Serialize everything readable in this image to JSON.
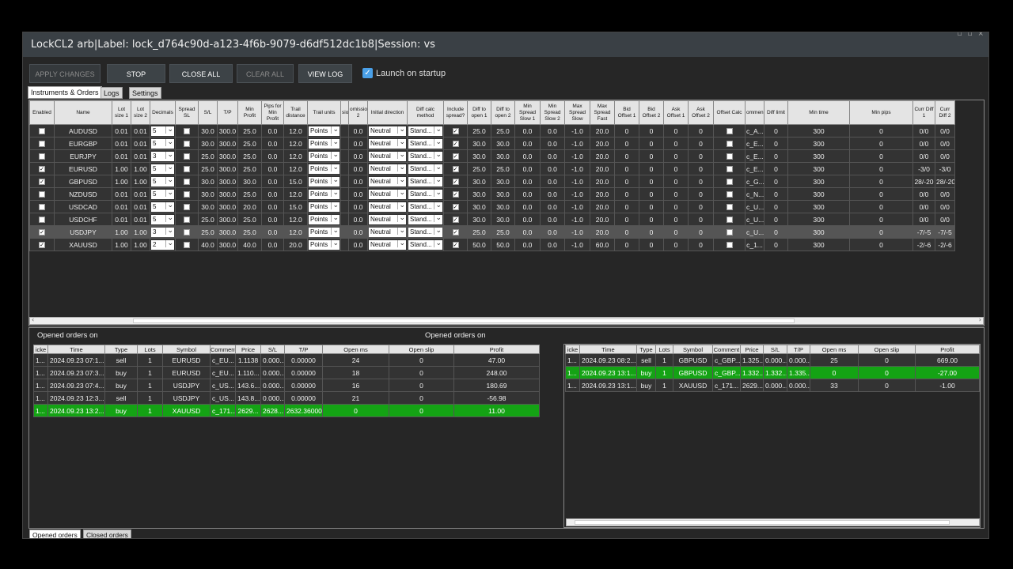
{
  "window": {
    "title": "LockCL2 arb|Label: lock_d764c90d-a123-4f6b-9079-d6df512dc1b8|Session:  vs"
  },
  "toolbar": {
    "apply_label": "APPLY CHANGES",
    "stop_label": "STOP",
    "close_all_label": "CLOSE ALL",
    "clear_all_label": "CLEAR ALL",
    "view_log_label": "VIEW LOG",
    "launch_label": "Launch on startup",
    "launch_checked": true
  },
  "tabs": [
    "Instruments & Orders",
    "Logs",
    "Settings"
  ],
  "instruments": {
    "columns": [
      "Enabled",
      "Name",
      "Lot size 1",
      "Lot size 2",
      "Decimals",
      "Spread SL",
      "S/L",
      "T/P",
      "Min Profit",
      "Pips for Min Profit",
      "Trail distance",
      "Trail units",
      "sio",
      "omissio 2",
      "Initial direction",
      "Diff calc method",
      "Include spread?",
      "Diff to open 1",
      "Diff to open 2",
      "Min Spread Slow 1",
      "Min Spread Slow 2",
      "Max Spread Slow",
      "Max Spread Fast",
      "Bid Offset 1",
      "Bid Offset 2",
      "Ask Offset 1",
      "Ask Offset 2",
      "Offset Calc",
      "ommen",
      "Diff limit",
      "Min time",
      "Min pips",
      "Curr Diff 1",
      "Curr Diff 2"
    ],
    "rows": [
      {
        "enabled": false,
        "cells": [
          "AUDUSD",
          "0.01",
          "0.01",
          "5",
          "",
          "30.0",
          "300.0",
          "25.0",
          "0.0",
          "12.0",
          "Points",
          "",
          "0.0",
          "Neutral",
          "Stand...",
          "",
          "25.0",
          "25.0",
          "0.0",
          "0.0",
          "-1.0",
          "20.0",
          "0",
          "0",
          "0",
          "0",
          "",
          "c_A...",
          "0",
          "300",
          "0",
          "0/0",
          "0/0"
        ],
        "spread_sl": false,
        "include_spread": true,
        "offset_calc": false
      },
      {
        "enabled": false,
        "cells": [
          "EURGBP",
          "0.01",
          "0.01",
          "5",
          "",
          "30.0",
          "300.0",
          "25.0",
          "0.0",
          "12.0",
          "Points",
          "",
          "0.0",
          "Neutral",
          "Stand...",
          "",
          "30.0",
          "30.0",
          "0.0",
          "0.0",
          "-1.0",
          "20.0",
          "0",
          "0",
          "0",
          "0",
          "",
          "c_E...",
          "0",
          "300",
          "0",
          "0/0",
          "0/0"
        ],
        "spread_sl": false,
        "include_spread": true,
        "offset_calc": false
      },
      {
        "enabled": false,
        "cells": [
          "EURJPY",
          "0.01",
          "0.01",
          "3",
          "",
          "25.0",
          "300.0",
          "25.0",
          "0.0",
          "12.0",
          "Points",
          "",
          "0.0",
          "Neutral",
          "Stand...",
          "",
          "30.0",
          "30.0",
          "0.0",
          "0.0",
          "-1.0",
          "20.0",
          "0",
          "0",
          "0",
          "0",
          "",
          "c_E...",
          "0",
          "300",
          "0",
          "0/0",
          "0/0"
        ],
        "spread_sl": false,
        "include_spread": true,
        "offset_calc": false
      },
      {
        "enabled": true,
        "cells": [
          "EURUSD",
          "1.00",
          "1.00",
          "5",
          "",
          "25.0",
          "300.0",
          "25.0",
          "0.0",
          "12.0",
          "Points",
          "",
          "0.0",
          "Neutral",
          "Stand...",
          "",
          "25.0",
          "25.0",
          "0.0",
          "0.0",
          "-1.0",
          "20.0",
          "0",
          "0",
          "0",
          "0",
          "",
          "c_E...",
          "0",
          "300",
          "0",
          "-3/0",
          "-3/0"
        ],
        "spread_sl": false,
        "include_spread": true,
        "offset_calc": false
      },
      {
        "enabled": true,
        "cells": [
          "GBPUSD",
          "1.00",
          "1.00",
          "5",
          "",
          "30.0",
          "300.0",
          "30.0",
          "0.0",
          "15.0",
          "Points",
          "",
          "0.0",
          "Neutral",
          "Stand...",
          "",
          "30.0",
          "30.0",
          "0.0",
          "0.0",
          "-1.0",
          "20.0",
          "0",
          "0",
          "0",
          "0",
          "",
          "c_G...",
          "0",
          "300",
          "0",
          "28/-20",
          "28/-20"
        ],
        "spread_sl": false,
        "include_spread": true,
        "offset_calc": false
      },
      {
        "enabled": false,
        "cells": [
          "NZDUSD",
          "0.01",
          "0.01",
          "5",
          "",
          "30.0",
          "300.0",
          "25.0",
          "0.0",
          "12.0",
          "Points",
          "",
          "0.0",
          "Neutral",
          "Stand...",
          "",
          "30.0",
          "30.0",
          "0.0",
          "0.0",
          "-1.0",
          "20.0",
          "0",
          "0",
          "0",
          "0",
          "",
          "c_N...",
          "0",
          "300",
          "0",
          "0/0",
          "0/0"
        ],
        "spread_sl": false,
        "include_spread": true,
        "offset_calc": false
      },
      {
        "enabled": false,
        "cells": [
          "USDCAD",
          "0.01",
          "0.01",
          "5",
          "",
          "30.0",
          "300.0",
          "20.0",
          "0.0",
          "15.0",
          "Points",
          "",
          "0.0",
          "Neutral",
          "Stand...",
          "",
          "30.0",
          "30.0",
          "0.0",
          "0.0",
          "-1.0",
          "20.0",
          "0",
          "0",
          "0",
          "0",
          "",
          "c_U...",
          "0",
          "300",
          "0",
          "0/0",
          "0/0"
        ],
        "spread_sl": false,
        "include_spread": true,
        "offset_calc": false
      },
      {
        "enabled": false,
        "cells": [
          "USDCHF",
          "0.01",
          "0.01",
          "5",
          "",
          "25.0",
          "300.0",
          "25.0",
          "0.0",
          "12.0",
          "Points",
          "",
          "0.0",
          "Neutral",
          "Stand...",
          "",
          "30.0",
          "30.0",
          "0.0",
          "0.0",
          "-1.0",
          "20.0",
          "0",
          "0",
          "0",
          "0",
          "",
          "c_U...",
          "0",
          "300",
          "0",
          "0/0",
          "0/0"
        ],
        "spread_sl": false,
        "include_spread": true,
        "offset_calc": false
      },
      {
        "enabled": true,
        "cells": [
          "USDJPY",
          "1.00",
          "1.00",
          "3",
          "",
          "25.0",
          "300.0",
          "25.0",
          "0.0",
          "12.0",
          "Points",
          "",
          "0.0",
          "Neutral",
          "Stand...",
          "",
          "25.0",
          "25.0",
          "0.0",
          "0.0",
          "-1.0",
          "20.0",
          "0",
          "0",
          "0",
          "0",
          "",
          "c_U...",
          "0",
          "300",
          "0",
          "-7/-5",
          "-7/-5"
        ],
        "spread_sl": false,
        "include_spread": true,
        "offset_calc": false,
        "selected": true
      },
      {
        "enabled": true,
        "cells": [
          "XAUUSD",
          "1.00",
          "1.00",
          "2",
          "",
          "40.0",
          "300.0",
          "40.0",
          "0.0",
          "20.0",
          "Points",
          "",
          "0.0",
          "Neutral",
          "Stand...",
          "",
          "50.0",
          "50.0",
          "0.0",
          "0.0",
          "-1.0",
          "60.0",
          "0",
          "0",
          "0",
          "0",
          "",
          "c_1...",
          "0",
          "300",
          "0",
          "-2/-6",
          "-2/-6"
        ],
        "spread_sl": false,
        "include_spread": true,
        "offset_calc": false
      }
    ]
  },
  "orders": {
    "left_title": "Opened orders on",
    "right_title": "Opened orders on",
    "left_columns": [
      "icke",
      "Time",
      "Type",
      "Lots",
      "Symbol",
      "Comment",
      "Price",
      "S/L",
      "T/P",
      "Open ms",
      "Open slip",
      "Profit"
    ],
    "left_rows": [
      {
        "hl": false,
        "cells": [
          "1...",
          "2024.09.23 07:1...",
          "sell",
          "1",
          "EURUSD",
          "c_EU...",
          "1.1138",
          "0.000...",
          "0.00000",
          "24",
          "0",
          "47.00"
        ]
      },
      {
        "hl": false,
        "cells": [
          "1...",
          "2024.09.23 07:3...",
          "buy",
          "1",
          "EURUSD",
          "c_EU...",
          "1.110...",
          "0.000...",
          "0.00000",
          "18",
          "0",
          "248.00"
        ]
      },
      {
        "hl": false,
        "cells": [
          "1...",
          "2024.09.23 07:4...",
          "buy",
          "1",
          "USDJPY",
          "c_US...",
          "143.6...",
          "0.000...",
          "0.00000",
          "16",
          "0",
          "180.69"
        ]
      },
      {
        "hl": false,
        "cells": [
          "1...",
          "2024.09.23 12:3...",
          "sell",
          "1",
          "USDJPY",
          "c_US...",
          "143.8...",
          "0.000...",
          "0.00000",
          "21",
          "0",
          "-56.98"
        ]
      },
      {
        "hl": true,
        "cells": [
          "1...",
          "2024.09.23 13:2...",
          "buy",
          "1",
          "XAUUSD",
          "c_171...",
          "2629...",
          "2628...",
          "2632.36000",
          "0",
          "0",
          "11.00"
        ]
      }
    ],
    "right_columns": [
      "icke",
      "Time",
      "Type",
      "Lots",
      "Symbol",
      "Comment",
      "Price",
      "S/L",
      "T/P",
      "Open ms",
      "Open slip",
      "Profit"
    ],
    "right_rows": [
      {
        "hl": false,
        "cells": [
          "1...",
          "2024.09.23 08:2...",
          "sell",
          "1",
          "GBPUSD",
          "c_GBP...",
          "1.325...",
          "0.000...",
          "0.000...",
          "25",
          "0",
          "669.00"
        ]
      },
      {
        "hl": true,
        "cells": [
          "1...",
          "2024.09.23 13:1...",
          "buy",
          "1",
          "GBPUSD",
          "c_GBP...",
          "1.332...",
          "1.332...",
          "1.335...",
          "0",
          "0",
          "-27.00"
        ]
      },
      {
        "hl": false,
        "cells": [
          "1...",
          "2024.09.23 13:1...",
          "buy",
          "1",
          "XAUUSD",
          "c_171...",
          "2629...",
          "0.000...",
          "0.000...",
          "33",
          "0",
          "-1.00"
        ]
      }
    ]
  },
  "bottom_tabs": [
    "Opened orders",
    "Closed orders"
  ],
  "colors": {
    "highlight": "#14a314",
    "accent": "#4aa0e8"
  }
}
